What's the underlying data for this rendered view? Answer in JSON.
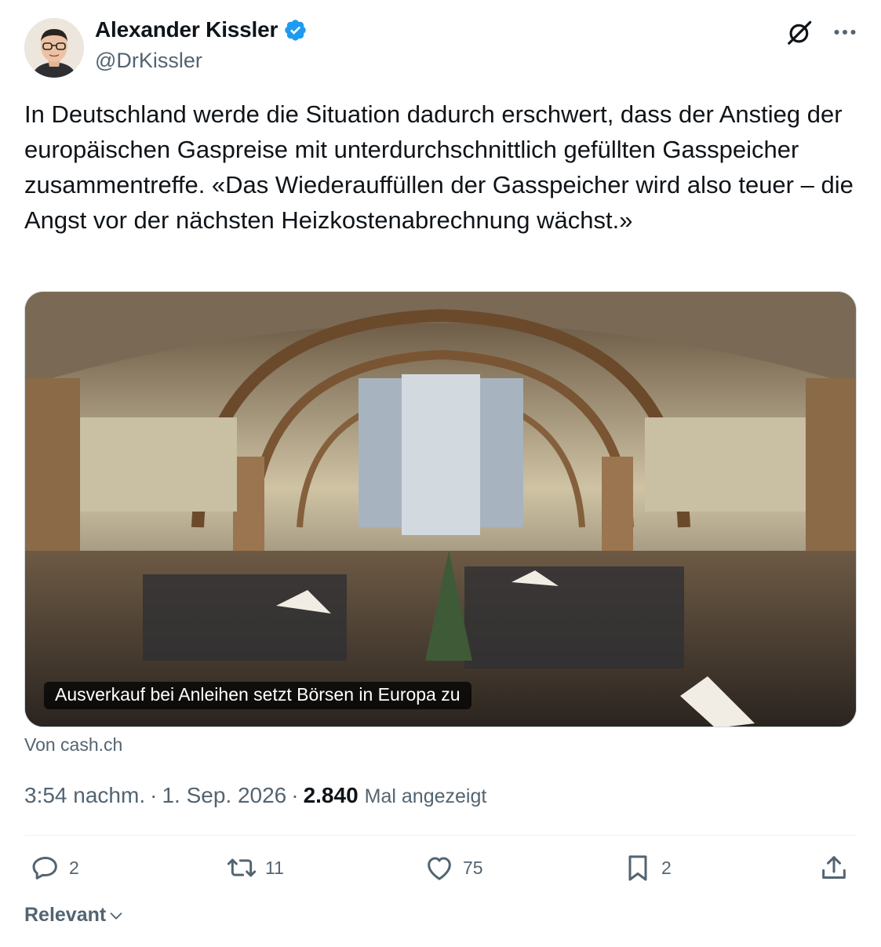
{
  "author": {
    "display_name": "Alexander Kissler",
    "handle": "@DrKissler",
    "verified": true
  },
  "tweet": {
    "text": "In Deutschland werde die Situation dadurch erschwert, dass der Anstieg der europäischen Gaspreise mit unterdurchschnittlich gefüllten Gasspeicher zusammentreffe. «Das Wiederauffüllen der Gasspeicher wird also teuer – die Angst vor der nächsten Heizkostenabrechnung wächst.»"
  },
  "link_card": {
    "title": "Ausverkauf bei Anleihen setzt Börsen in Europa zu",
    "source": "Von cash.ch",
    "image": "trading-floor-photo"
  },
  "meta": {
    "time": "3:54 nachm.",
    "separator": "·",
    "date": "1. Sep. 2026",
    "views": "2.840",
    "views_label": "Mal angezeigt"
  },
  "actions": {
    "replies": "2",
    "reposts": "11",
    "likes": "75",
    "bookmarks": "2"
  },
  "icons": [
    "grok-icon",
    "more-icon",
    "verified-badge-icon",
    "reply-icon",
    "repost-icon",
    "like-icon",
    "bookmark-icon",
    "share-icon",
    "chevron-down-icon"
  ],
  "sort": {
    "label": "Relevant"
  },
  "colors": {
    "text": "#0f1419",
    "secondary": "#536471",
    "verified": "#1d9bf0",
    "divider": "#eff3f4"
  }
}
